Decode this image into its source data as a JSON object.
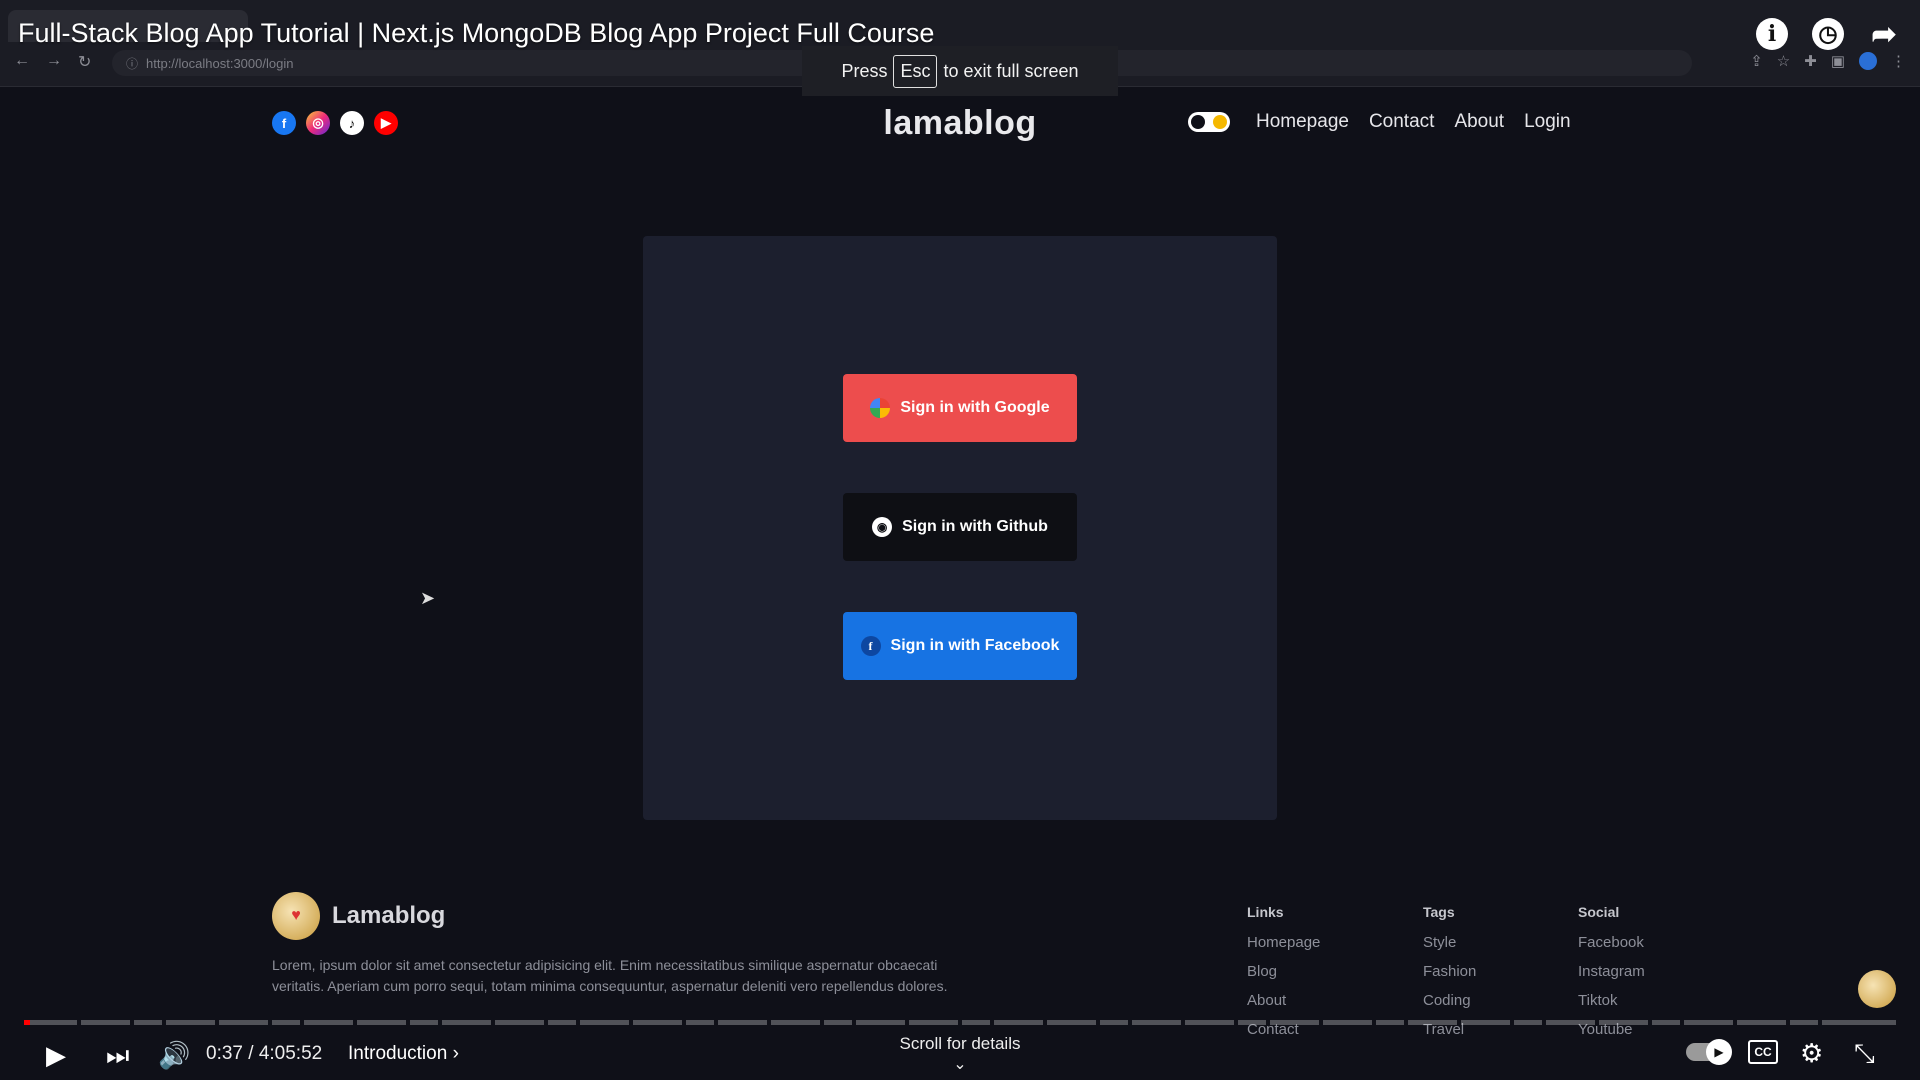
{
  "browser": {
    "url": "http://localhost:3000/login"
  },
  "video": {
    "title": "Full-Stack Blog App Tutorial | Next.js MongoDB Blog App Project Full Course",
    "esc_press": "Press",
    "esc_key": "Esc",
    "esc_suffix": "to exit full screen"
  },
  "site": {
    "logo": "lamablog",
    "nav": [
      "Homepage",
      "Contact",
      "About",
      "Login"
    ],
    "social_icons": [
      "facebook-icon",
      "instagram-icon",
      "tiktok-icon",
      "youtube-icon"
    ]
  },
  "login": {
    "google_label": "Sign in with Google",
    "github_label": "Sign in with Github",
    "facebook_label": "Sign in with Facebook",
    "colors": {
      "google": "#ed4d4d",
      "github": "#0e0f14",
      "facebook": "#1773e3"
    }
  },
  "footer": {
    "brand": "Lamablog",
    "description": "Lorem, ipsum dolor sit amet consectetur adipisicing elit. Enim necessitatibus similique aspernatur obcaecati veritatis. Aperiam cum porro sequi, totam minima consequuntur, aspernatur deleniti vero repellendus dolores.",
    "links": {
      "title": "Links",
      "items": [
        "Homepage",
        "Blog",
        "About",
        "Contact"
      ]
    },
    "tags": {
      "title": "Tags",
      "items": [
        "Style",
        "Fashion",
        "Coding",
        "Travel"
      ]
    },
    "social": {
      "title": "Social",
      "items": [
        "Facebook",
        "Instagram",
        "Tiktok",
        "Youtube"
      ]
    }
  },
  "player": {
    "current_time": "0:37",
    "duration": "4:05:52",
    "time_text": "0:37 / 4:05:52",
    "chapter": "Introduction",
    "scroll_hint": "Scroll for details",
    "progress_fraction": 0.0025
  }
}
